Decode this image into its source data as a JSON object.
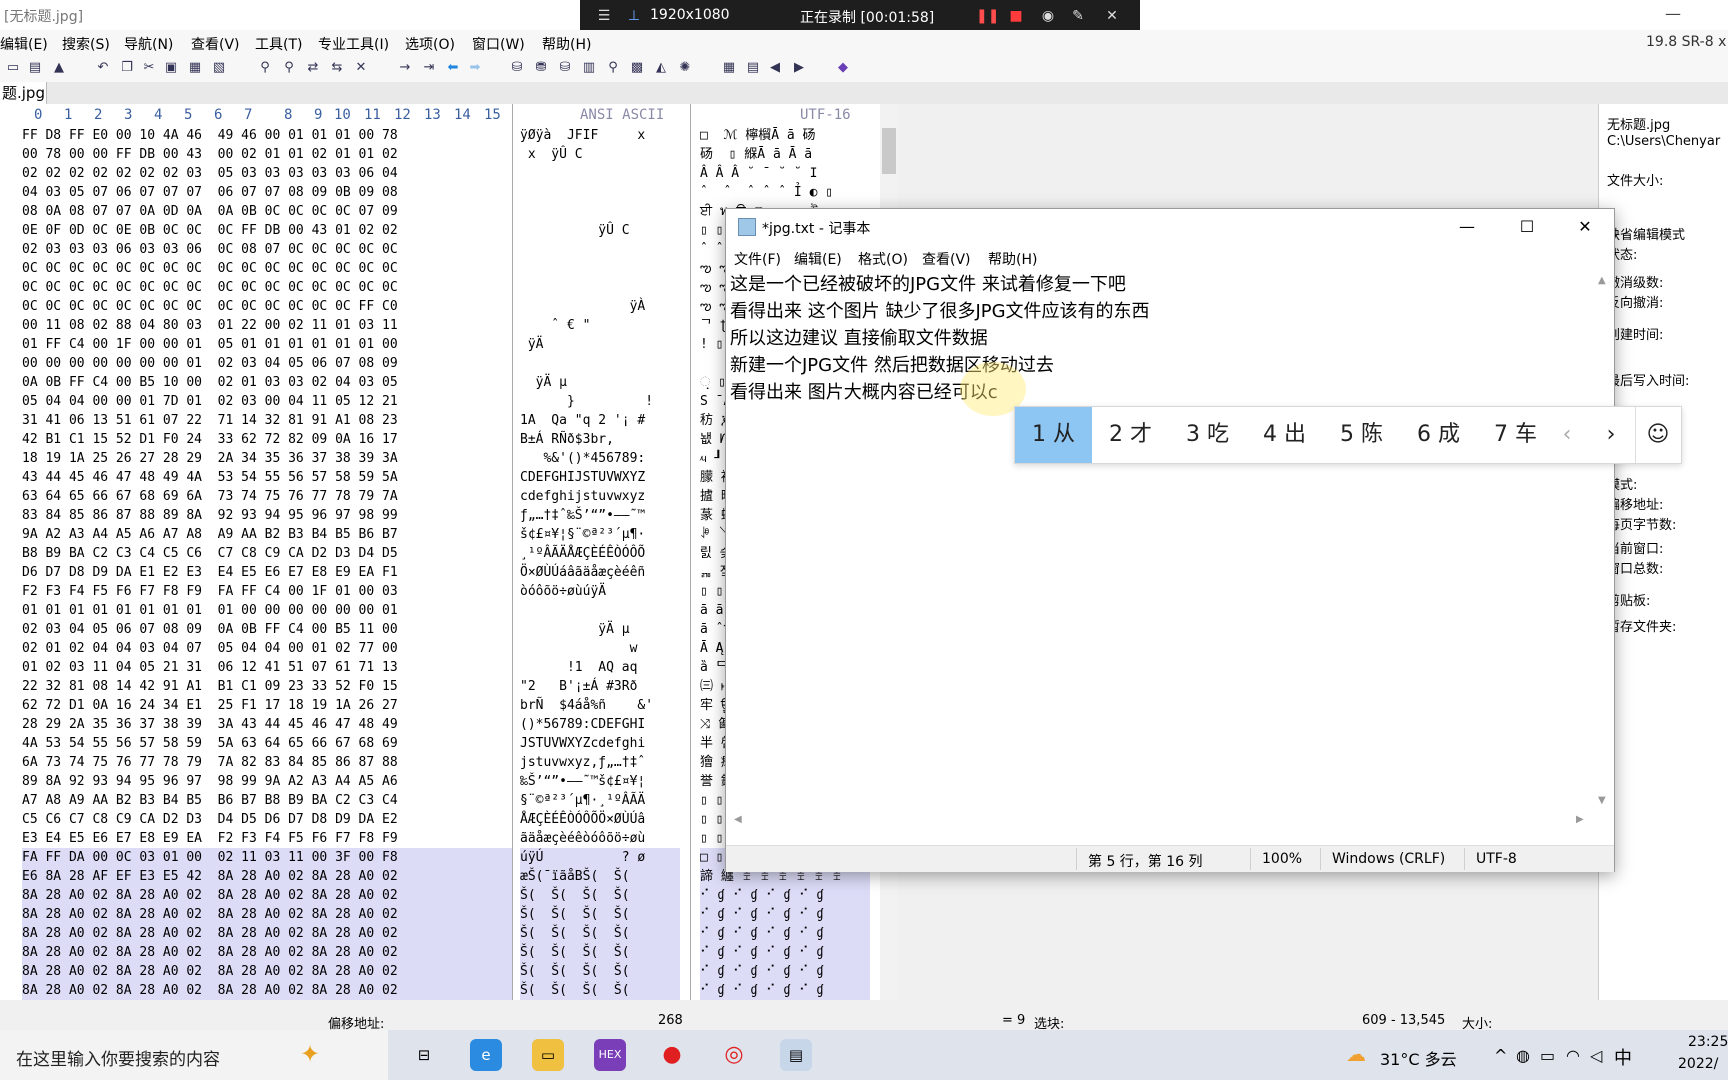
{
  "app": {
    "title": "[无标题.jpg]",
    "version": "19.8 SR-8 x"
  },
  "recorder": {
    "resolution": "1920x1080",
    "status": "正在录制 [00:01:58]"
  },
  "menu": [
    "编辑(E)",
    "搜索(S)",
    "导航(N)",
    "查看(V)",
    "工具(T)",
    "专业工具(I)",
    "选项(O)",
    "窗口(W)",
    "帮助(H)"
  ],
  "tab": {
    "label": "题.jpg"
  },
  "hex_header": {
    "cols": [
      "0",
      "1",
      "2",
      "3",
      "4",
      "5",
      "6",
      "7",
      "8",
      "9",
      "10",
      "11",
      "12",
      "13",
      "14",
      "15"
    ],
    "ansi": "ANSI ASCII",
    "utf": "UTF-16"
  },
  "hex_rows": [
    {
      "hex": "FF D8 FF E0 00 10 4A 46  49 46 00 01 01 01 00 78",
      "ansi": "ÿØÿà  JFIF     x",
      "utf": "□  ℳ 檸橮Ā ā 砀"
    },
    {
      "hex": "00 78 00 00 FF DB 00 43  00 02 01 01 02 01 01 02",
      "ansi": " x  ÿÛ C        ",
      "utf": "砀  ▯ 緥Ā ā Ā ā"
    },
    {
      "hex": "02 02 02 02 02 02 02 03  05 03 03 03 03 03 06 04",
      "ansi": "                ",
      "utf": "Â Â Â ˘ ¯ ˘ ˘ Ι"
    },
    {
      "hex": "04 03 05 07 06 07 07 07  06 07 07 08 09 0B 09 08",
      "ansi": "                ",
      "utf": "ˆ  ˆ  ˆ ˆ ˆ Ỉ ◐ ▯"
    },
    {
      "hex": "08 0A 08 07 07 0A 0D 0A  0A 0B 0C 0C 0C 0C 07 09",
      "ansi": "                ",
      "utf": "ਈ ท ਊ ଊ ఌ ఌ ই"
    },
    {
      "hex": "0E 0F 0D 0C 0E 0B 0C 0C  0C FF DB 00 43 01 02 02",
      "ansi": "          ÿÛ C   ",
      "utf": "▯ ▯ ▯ ▯ ▯ ▯ ▯ ▯"
    },
    {
      "hex": "02 03 03 03 06 03 03 06  0C 08 07 0C 0C 0C 0C 0C",
      "ansi": "                ",
      "utf": "ˆ ˆ ˆ ˆ ˆ ˆ ˆ ˆ"
    },
    {
      "hex": "0C 0C 0C 0C 0C 0C 0C 0C  0C 0C 0C 0C 0C 0C 0C 0C",
      "ansi": "                ",
      "utf": "ఌ ఌ ఌ ఌ ఌ ఌ ఌ ఌ"
    },
    {
      "hex": "0C 0C 0C 0C 0C 0C 0C 0C  0C 0C 0C 0C 0C 0C 0C 0C",
      "ansi": "                ",
      "utf": "ఌ ఌ ఌ ఌ ఌ ఌ ఌ ఌ"
    },
    {
      "hex": "0C 0C 0C 0C 0C 0C 0C 0C  0C 0C 0C 0C 0C 0C FF C0",
      "ansi": "              ÿÀ",
      "utf": "ఌ ఌ ఌ ఌ ఌ ఌ ఌ 샿"
    },
    {
      "hex": "00 11 08 02 88 04 80 03  01 22 00 02 11 01 03 11",
      "ansi": "    ˆ € \"       ",
      "utf": "ᄀ ʈ 胀 ĭ ȁ Ą ᄃ"
    },
    {
      "hex": "01 FF C4 00 1F 00 00 01  05 01 01 01 01 01 01 00",
      "ansi": " ÿÄ             ",
      "utf": "! ▯ Ā ą ą ą ą ▯"
    },
    {
      "hex": "00 00 00 00 00 00 00 01  02 03 04 05 06 07 08 09",
      "ansi": "                ",
      "utf": "     Ā ̂ Ԅ ܆ ও"
    },
    {
      "hex": "0A 0B FF C4 00 B5 10 00  02 01 03 03 02 04 03 05",
      "ansi": "  ÿÄ µ          ",
      "utf": "଼ ▯ 뗄 ၀ Ă ̃ Ђ Ճ"
    },
    {
      "hex": "05 04 04 00 00 01 7D 01  02 03 00 04 11 05 12 21",
      "ansi": "      }         !",
      "utf": "Ѕ ̄ Ā 17D ̂ Ѐ ԑ ℒ"
    },
    {
      "hex": "31 41 06 13 51 61 07 22  71 14 32 81 91 A1 08 23",
      "ansi": "1A  Qa \"q 2 '¡ #",
      "utf": "䄱 ጆ 慑 ∇ ᑱ 腲 ꆑ ⌈"
    },
    {
      "hex": "42 B1 C1 15 52 D1 F0 24  33 62 72 82 09 0A 16 17",
      "ansi": "B±Á RÑð$3br,    ",
      "utf": "뇂 ᗁ 톒 Ⓒ 戳 色 ਉ ᜖"
    },
    {
      "hex": "18 19 1A 25 26 27 28 29  2A 34 35 36 37 38 39 3A",
      "ansi": "   %&'()*456789:",
      "utf": "ᤘ ┚ ✦ ⤨ 㐪 㘵 㠷 㨹"
    },
    {
      "hex": "43 44 45 46 47 48 49 4A  53 54 55 56 57 58 59 5A",
      "ansi": "CDEFGHIJSTUVWXYZ",
      "utf": "䑃 䙅 䡇 䩉 呓 噕 塗 婙"
    },
    {
      "hex": "63 64 65 66 67 68 69 6A  73 74 75 76 77 78 79 7A",
      "ansi": "cdefghijstuvwxyz",
      "utf": "摣 晥 桧 橩 瑳 癵 硷 穹"
    },
    {
      "hex": "83 84 85 86 87 88 89 8A  92 93 94 95 96 97 98 99",
      "ansi": "ƒ„…†‡ˆ‰Š’“”•–—˜™",
      "utf": "蒃 蚅 袇 誉 鎒 閔 鞖 馘"
    },
    {
      "hex": "9A A2 A3 A4 A5 A6 A7 A8  A9 AA B2 B3 B4 B5 B6 B7",
      "ansi": "š¢£¤¥¦§¨©ª²³´µ¶·",
      "utf": "ꊚ ꒣ ꚥ ꢧ ꪩ 뎲 떴 랶"
    },
    {
      "hex": "B8 B9 BA C2 C3 C4 C5 C6  C7 C8 C9 CA D2 D3 D4 D5",
      "ansi": "¸¹ºÂÃÄÅÆÇÈÉÊÒÓÔÕ",
      "utf": "릸 슺 쓃 욅 죇 쫉 폒 헔"
    },
    {
      "hex": "D6 D7 D8 D9 DA E1 E2 E3  E4 E5 E6 E7 E8 E9 EA F1",
      "ansi": "Ö×ØÙÚáâãäåæçèéêñ",
      "utf": "ퟖ 짘 ▯ ▯ ▯ ▯ ▯ ▯"
    },
    {
      "hex": "F2 F3 F4 F5 F6 F7 F8 F9  FA FF C4 00 1F 01 00 03",
      "ansi": "òóôõö÷øùúÿÄ     ",
      "utf": "▯ ▯ ▯ ▯ ▯ ▯ ▯ ▯"
    },
    {
      "hex": "01 01 01 01 01 01 01 01  01 00 00 00 00 00 00 01",
      "ansi": "                ",
      "utf": "ā ā ā ā ā      "
    },
    {
      "hex": "02 03 04 05 06 07 08 09  0A 0B FF C4 00 B5 11 00",
      "ansi": "          ÿÄ µ  ",
      "utf": "ā ̂ Ԅ ܆ ও ଊ ▯ ▯"
    },
    {
      "hex": "02 01 02 04 04 03 04 07  05 04 04 00 01 02 77 00",
      "ansi": "              w ",
      "utf": "Ā Ą ̄ ܄ Ѕ ̄ Ā 簀"
    },
    {
      "hex": "01 02 03 11 04 05 21 31  06 12 41 51 07 61 71 13",
      "ansi": "      !1  AQ aq ",
      "utf": "ȁ ᄃ Ԅ ㄁ ሆ 煑 ᆭ ፱"
    },
    {
      "hex": "22 32 81 08 14 42 91 A1  B1 C1 09 23 33 52 F0 15",
      "ansi": "\"2   B'¡±Á #3Rð ",
      "utf": "㈢ ࢁ 䈔 ꆑ 쇁 ⌉ 刳 ᗰ"
    },
    {
      "hex": "62 72 D1 0A 16 24 34 E1  25 F1 17 18 19 1A 26 27",
      "ansi": "brÑ  $4áå%ñ    &'",
      "utf": "牢 ਊ Ⓗ ▯ ▯ ᠗ ᨙ ✦"
    },
    {
      "hex": "28 29 2A 35 36 37 38 39  3A 43 44 45 46 47 48 49",
      "ansi": "()*56789:CDEFGHI",
      "utf": "⤨ 㔪 㜶 㤸 䌺 䕄 䝆 䥈"
    },
    {
      "hex": "4A 53 54 55 56 57 58 59  5A 63 64 65 66 67 68 69",
      "ansi": "JSTUVWXYZcdefghi",
      "utf": "半 啔 坖 奘 捚 敤 杦 楨"
    },
    {
      "hex": "6A 73 74 75 76 77 78 79  7A 82 83 84 85 86 87 88",
      "ansi": "jstuvwxyz,ƒ„…†‡ˆ",
      "utf": "獪 癴 硶 穸 芀 蒃 蚅 袇"
    },
    {
      "hex": "89 8A 92 93 94 95 96 97  98 99 9A A2 A3 A4 A5 A6",
      "ansi": "‰Š’“”•–—˜™š¢£¤¥¦",
      "utf": "誉 鎒 閔 鞖 馘 ꊚ ꒣ ꚥ"
    },
    {
      "hex": "A7 A8 A9 AA B2 B3 B4 B5  B6 B7 B8 B9 BA C2 C3 C4",
      "ansi": "§¨©ª²³´µ¶·¸¹ºÂÃÄ",
      "utf": "▯ ▯ ▯ ▯ ▯ ▯ ▯ ▯"
    },
    {
      "hex": "C5 C6 C7 C8 C9 CA D2 D3  D4 D5 D6 D7 D8 D9 DA E2",
      "ansi": "ÅÆÇÈÉÊÒÓÔÕÖ×ØÙÚâ",
      "utf": "▯ ▯ ▯ ▯ ▯ ▯ ▯ ▯"
    },
    {
      "hex": "E3 E4 E5 E6 E7 E8 E9 EA  F2 F3 F4 F5 F6 F7 F8 F9",
      "ansi": "ãäåæçèéêòóôõö÷øù",
      "utf": "▯ ▯ ▯ ▯ ▯ ▯ ▯ ▯"
    },
    {
      "hex": "FA FF DA 00 0C 03 01 00  02 11 03 11 00 3F 00 F8",
      "ansi": "úÿÚ          ? ø",
      "utf": "□ ▯ ▯ ▯ ▯ ▯ ▯ ▯"
    },
    {
      "hex": "E6 8A 28 AF EF E3 E5 42  8A 28 A0 02 8A 28 A0 02",
      "ansi": "æŠ(¯ïãåBŠ(  Š( ",
      "utf": "諦 纏 ꀨ ꀨ ꀨ ꀨ ꀨ ꀨ"
    },
    {
      "hex": "8A 28 A0 02 8A 28 A0 02  8A 28 A0 02 8A 28 A0 02",
      "ansi": "Š(  Š(  Š(  Š(  ",
      "utf": "⠊ ɠ ⠊ ɠ ⠊ ɠ ⠊ ɠ"
    },
    {
      "hex": "8A 28 A0 02 8A 28 A0 02  8A 28 A0 02 8A 28 A0 02",
      "ansi": "Š(  Š(  Š(  Š(  ",
      "utf": "⠊ ɠ ⠊ ɠ ⠊ ɠ ⠊ ɠ"
    },
    {
      "hex": "8A 28 A0 02 8A 28 A0 02  8A 28 A0 02 8A 28 A0 02",
      "ansi": "Š(  Š(  Š(  Š(  ",
      "utf": "⠊ ɠ ⠊ ɠ ⠊ ɠ ⠊ ɠ"
    },
    {
      "hex": "8A 28 A0 02 8A 28 A0 02  8A 28 A0 02 8A 28 A0 02",
      "ansi": "Š(  Š(  Š(  Š(  ",
      "utf": "⠊ ɠ ⠊ ɠ ⠊ ɠ ⠊ ɠ"
    },
    {
      "hex": "8A 28 A0 02 8A 28 A0 02  8A 28 A0 02 8A 28 A0 02",
      "ansi": "Š(  Š(  Š(  Š(  ",
      "utf": "⠊ ɠ ⠊ ɠ ⠊ ɠ ⠊ ɠ"
    },
    {
      "hex": "8A 28 A0 02 8A 28 A0 02  8A 28 A0 02 8A 28 A0 02",
      "ansi": "Š(  Š(  Š(  Š(  ",
      "utf": "⠊ ɠ ⠊ ɠ ⠊ ɠ ⠊ ɠ"
    }
  ],
  "info_panel": [
    "无标题.jpg",
    "C:\\Users\\Chenyar",
    "文件大小:",
    "缺省编辑模式",
    "状态:",
    "撤消级数:",
    "反向撤消:",
    "创建时间:",
    "最后写入时间:",
    "模式:",
    "偏移地址:",
    "每页字节数:",
    "当前窗口:",
    "窗口总数:",
    "剪贴板:",
    "暂存文件夹:"
  ],
  "status_bar": {
    "offset_label": "偏移地址:",
    "offset_value": "268",
    "eq": "= 9",
    "sel_label": "选块:",
    "sel_range": "609 - 13,545",
    "size_label": "大小:"
  },
  "notepad": {
    "title": "*jpg.txt - 记事本",
    "menu": [
      "文件(F)",
      "编辑(E)",
      "格式(O)",
      "查看(V)",
      "帮助(H)"
    ],
    "lines": [
      "这是一个已经被破坏的JPG文件 来试着修复一下吧",
      "看得出来 这个图片 缺少了很多JPG文件应该有的东西",
      "所以这边建议 直接偷取文件数据",
      "新建一个JPG文件 然后把数据区移动过去",
      "看得出来 图片大概内容已经可以c"
    ],
    "status": {
      "pos": "第 5 行，第 16 列",
      "zoom": "100%",
      "eol": "Windows (CRLF)",
      "enc": "UTF-8"
    }
  },
  "ime": {
    "candidates": [
      "1 从",
      "2 才",
      "3 吃",
      "4 出",
      "5 陈",
      "6 成",
      "7 车"
    ]
  },
  "taskbar": {
    "search": "在这里输入你要搜索的内容",
    "weather": "31°C 多云",
    "lang": "中",
    "time": "23:25",
    "date": "2022/"
  },
  "colors": {
    "selection": "#dcdcf7",
    "hex_header": "#3a5fa0",
    "ime_active": "#8dc6f3"
  }
}
